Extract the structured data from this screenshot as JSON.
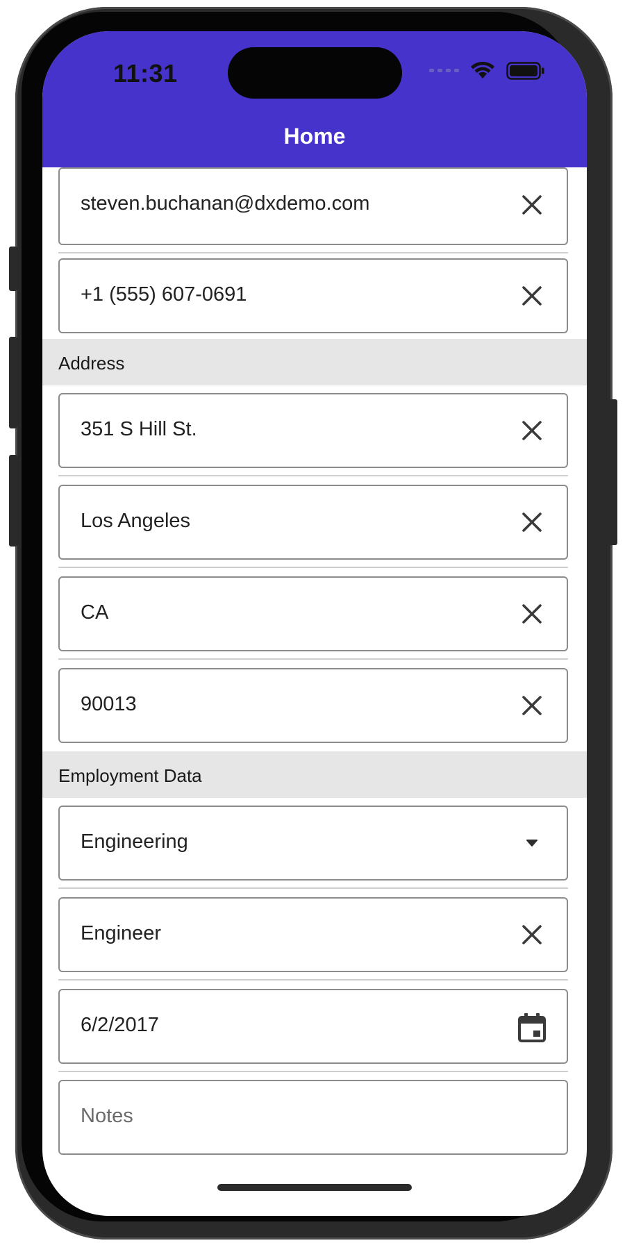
{
  "status_bar": {
    "time": "11:31"
  },
  "header": {
    "title": "Home",
    "background_color": "#4633cc"
  },
  "contact": {
    "email": "steven.buchanan@dxdemo.com",
    "phone": "+1 (555) 607-0691"
  },
  "address": {
    "section_label": "Address",
    "street": "351 S Hill St.",
    "city": "Los Angeles",
    "state": "CA",
    "zip": "90013"
  },
  "employment": {
    "section_label": "Employment Data",
    "department": "Engineering",
    "position": "Engineer",
    "hire_date": "6/2/2017",
    "notes_placeholder": "Notes"
  },
  "icons": {
    "clear": "close-icon",
    "dropdown": "caret-down-icon",
    "date": "calendar-icon"
  }
}
